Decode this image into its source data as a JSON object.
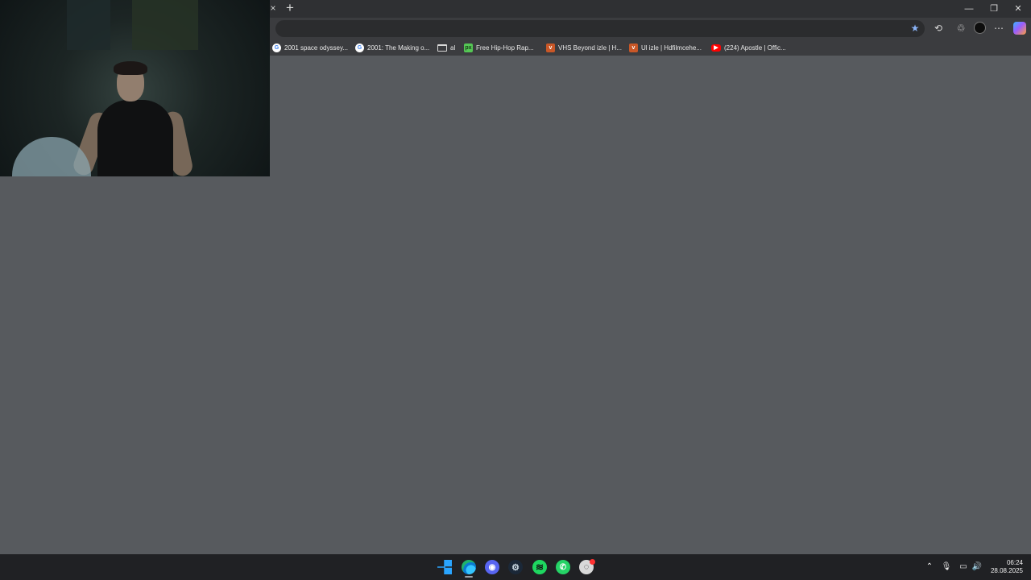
{
  "browser": {
    "tab_close_glyph": "×",
    "new_tab_glyph": "+",
    "window_controls": {
      "minimize": "—",
      "restore": "❐",
      "close": "✕"
    },
    "toolbar_icons": {
      "favorite": "star-icon",
      "extensions": "extension-icon",
      "browser_essentials": "shield-icon",
      "profile": "profile-avatar",
      "more": "more-dots-icon",
      "copilot": "copilot-icon"
    }
  },
  "bookmarks": [
    {
      "label": "2001 space odyssey...",
      "icon": "G"
    },
    {
      "label": "2001: The Making o...",
      "icon": "G"
    },
    {
      "label": "al",
      "icon": "folder-icon"
    },
    {
      "label": "Free Hip-Hop Rap...",
      "icon": "px"
    },
    {
      "label": "VHS Beyond izle | H...",
      "icon": "vhs"
    },
    {
      "label": "Ul izle | Hdfilmcehe...",
      "icon": "vhs"
    },
    {
      "label": "(224) Apostle | Offic...",
      "icon": "youtube"
    }
  ],
  "taskbar": {
    "apps": {
      "start": "windows-start-icon",
      "edge": "edge-icon",
      "discord": "◉",
      "steam": "⚙",
      "spotify": "≋",
      "whatsapp": "✆",
      "obs": "◌"
    },
    "tray_icons": {
      "chevron": "⌃",
      "microphone": "🎙",
      "network": "▭",
      "volume": "🔊"
    },
    "time": "06:24",
    "date": "28.08.2025"
  },
  "colors": {
    "page_background": "#575a5e",
    "accent": "#8ab4f8",
    "taskbar": "#202124"
  }
}
